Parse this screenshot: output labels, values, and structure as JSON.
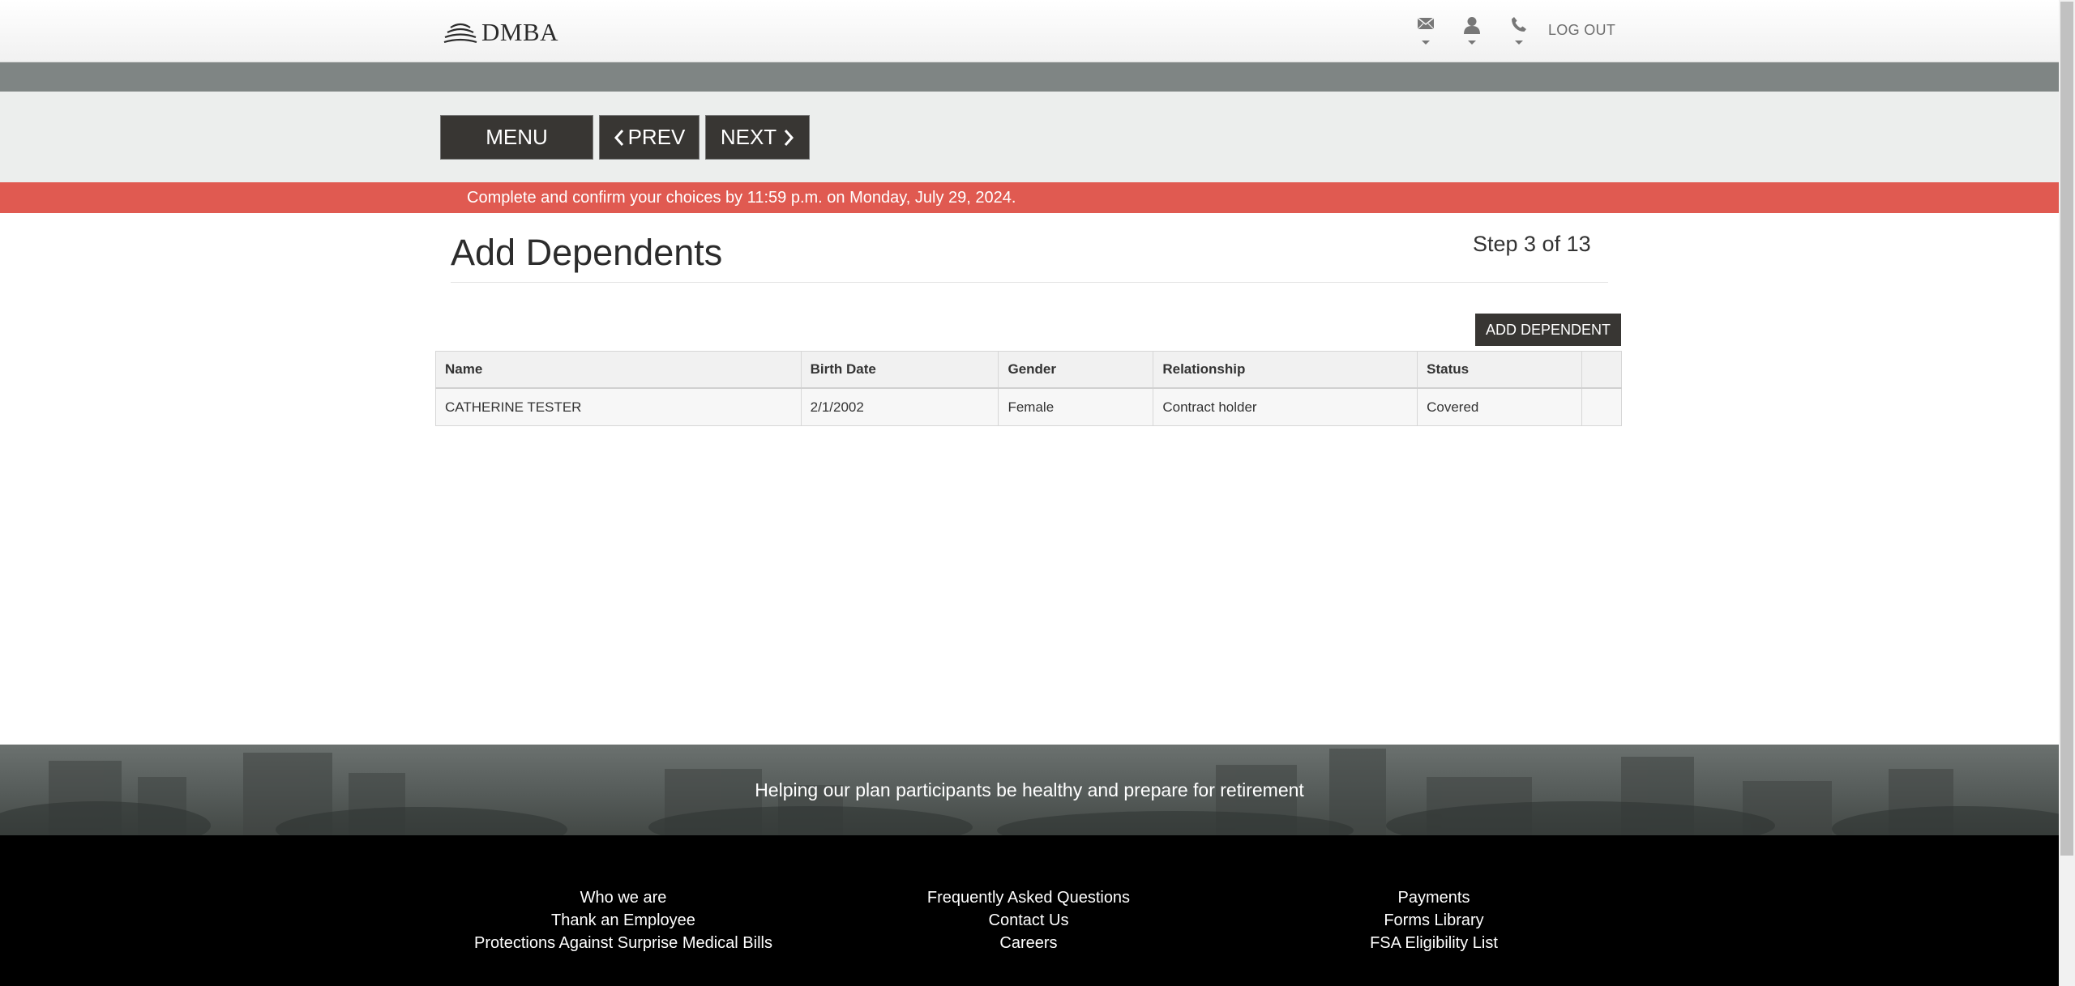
{
  "header": {
    "logo_text": "DMBA",
    "logout_label": "LOG OUT",
    "icons": [
      "mail-icon",
      "user-icon",
      "phone-icon"
    ]
  },
  "nav": {
    "menu_label": "MENU",
    "prev_label": "PREV",
    "next_label": "NEXT"
  },
  "alert": {
    "text": "Complete and confirm your choices by 11:59 p.m. on Monday, July 29, 2024."
  },
  "main": {
    "title": "Add Dependents",
    "step": "Step 3 of 13",
    "add_button_label": "ADD DEPENDENT",
    "table": {
      "columns": [
        "Name",
        "Birth Date",
        "Gender",
        "Relationship",
        "Status",
        ""
      ],
      "rows": [
        [
          "CATHERINE TESTER",
          "2/1/2002",
          "Female",
          "Contract holder",
          "Covered",
          ""
        ]
      ]
    }
  },
  "footer": {
    "tagline": "Helping our plan participants be healthy and prepare for retirement",
    "columns": [
      [
        "Who we are",
        "Thank an Employee",
        "Protections Against Surprise Medical Bills"
      ],
      [
        "Frequently Asked Questions",
        "Contact Us",
        "Careers"
      ],
      [
        "Payments",
        "Forms Library",
        "FSA Eligibility List"
      ]
    ]
  },
  "colors": {
    "alert": "#e05a51",
    "button_dark": "#383633",
    "band": "#7f8584",
    "nav_bg": "#eceeed",
    "footer_bg": "#000000"
  }
}
